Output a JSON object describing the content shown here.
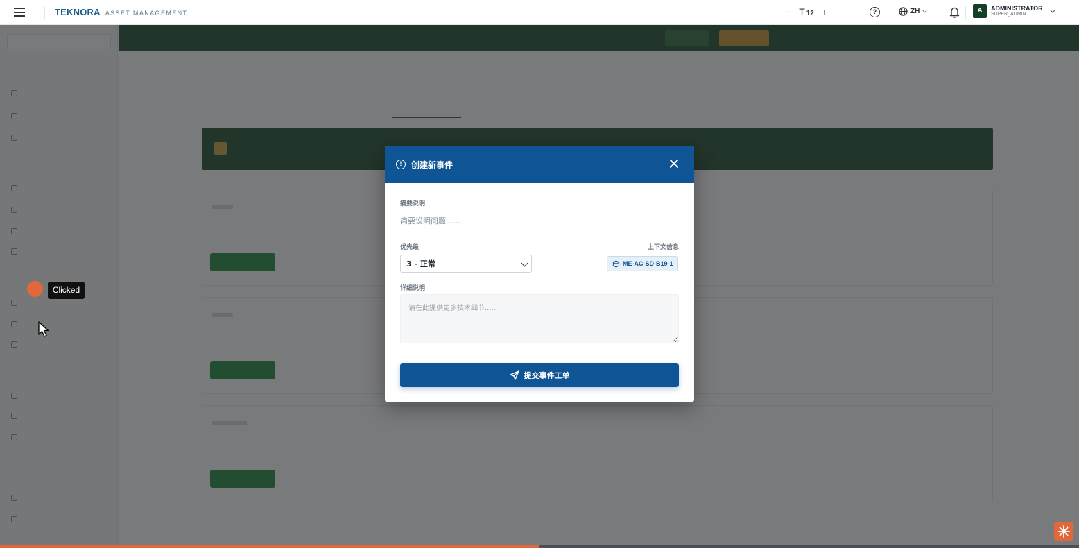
{
  "topbar": {
    "brand": "TEKNORA",
    "brand_sub": "ASSET MANAGEMENT",
    "font_minus": "−",
    "font_size_value": "12",
    "font_plus": "+",
    "language": "ZH",
    "user_name": "ADMINISTRATOR",
    "user_role": "SUPER_ADMIN",
    "avatar_letter": "A"
  },
  "modal": {
    "title": "创建新事件",
    "summary_label": "摘要说明",
    "summary_placeholder": "简要说明问题......",
    "priority_label": "优先级",
    "priority_selected": "3 - 正常",
    "context_label": "上下文信息",
    "context_badge": "ME-AC-SD-B19-1",
    "details_label": "详细说明",
    "details_placeholder": "请在此提供更多技术细节......",
    "submit_label": "提交事件工单"
  },
  "click_indicator": {
    "tooltip": "Clicked"
  },
  "video_progress": 0.5,
  "colors": {
    "modal_header": "#0f5495",
    "submit_button": "#0f5495",
    "click_dot": "#e0683a",
    "app_header_green": "#1c4a2c"
  },
  "icons": [
    "menu-icon",
    "text-size-icon",
    "help-icon",
    "globe-icon",
    "bell-icon",
    "alert-circle-icon",
    "close-icon",
    "cube-icon",
    "send-icon",
    "cursor-icon"
  ]
}
